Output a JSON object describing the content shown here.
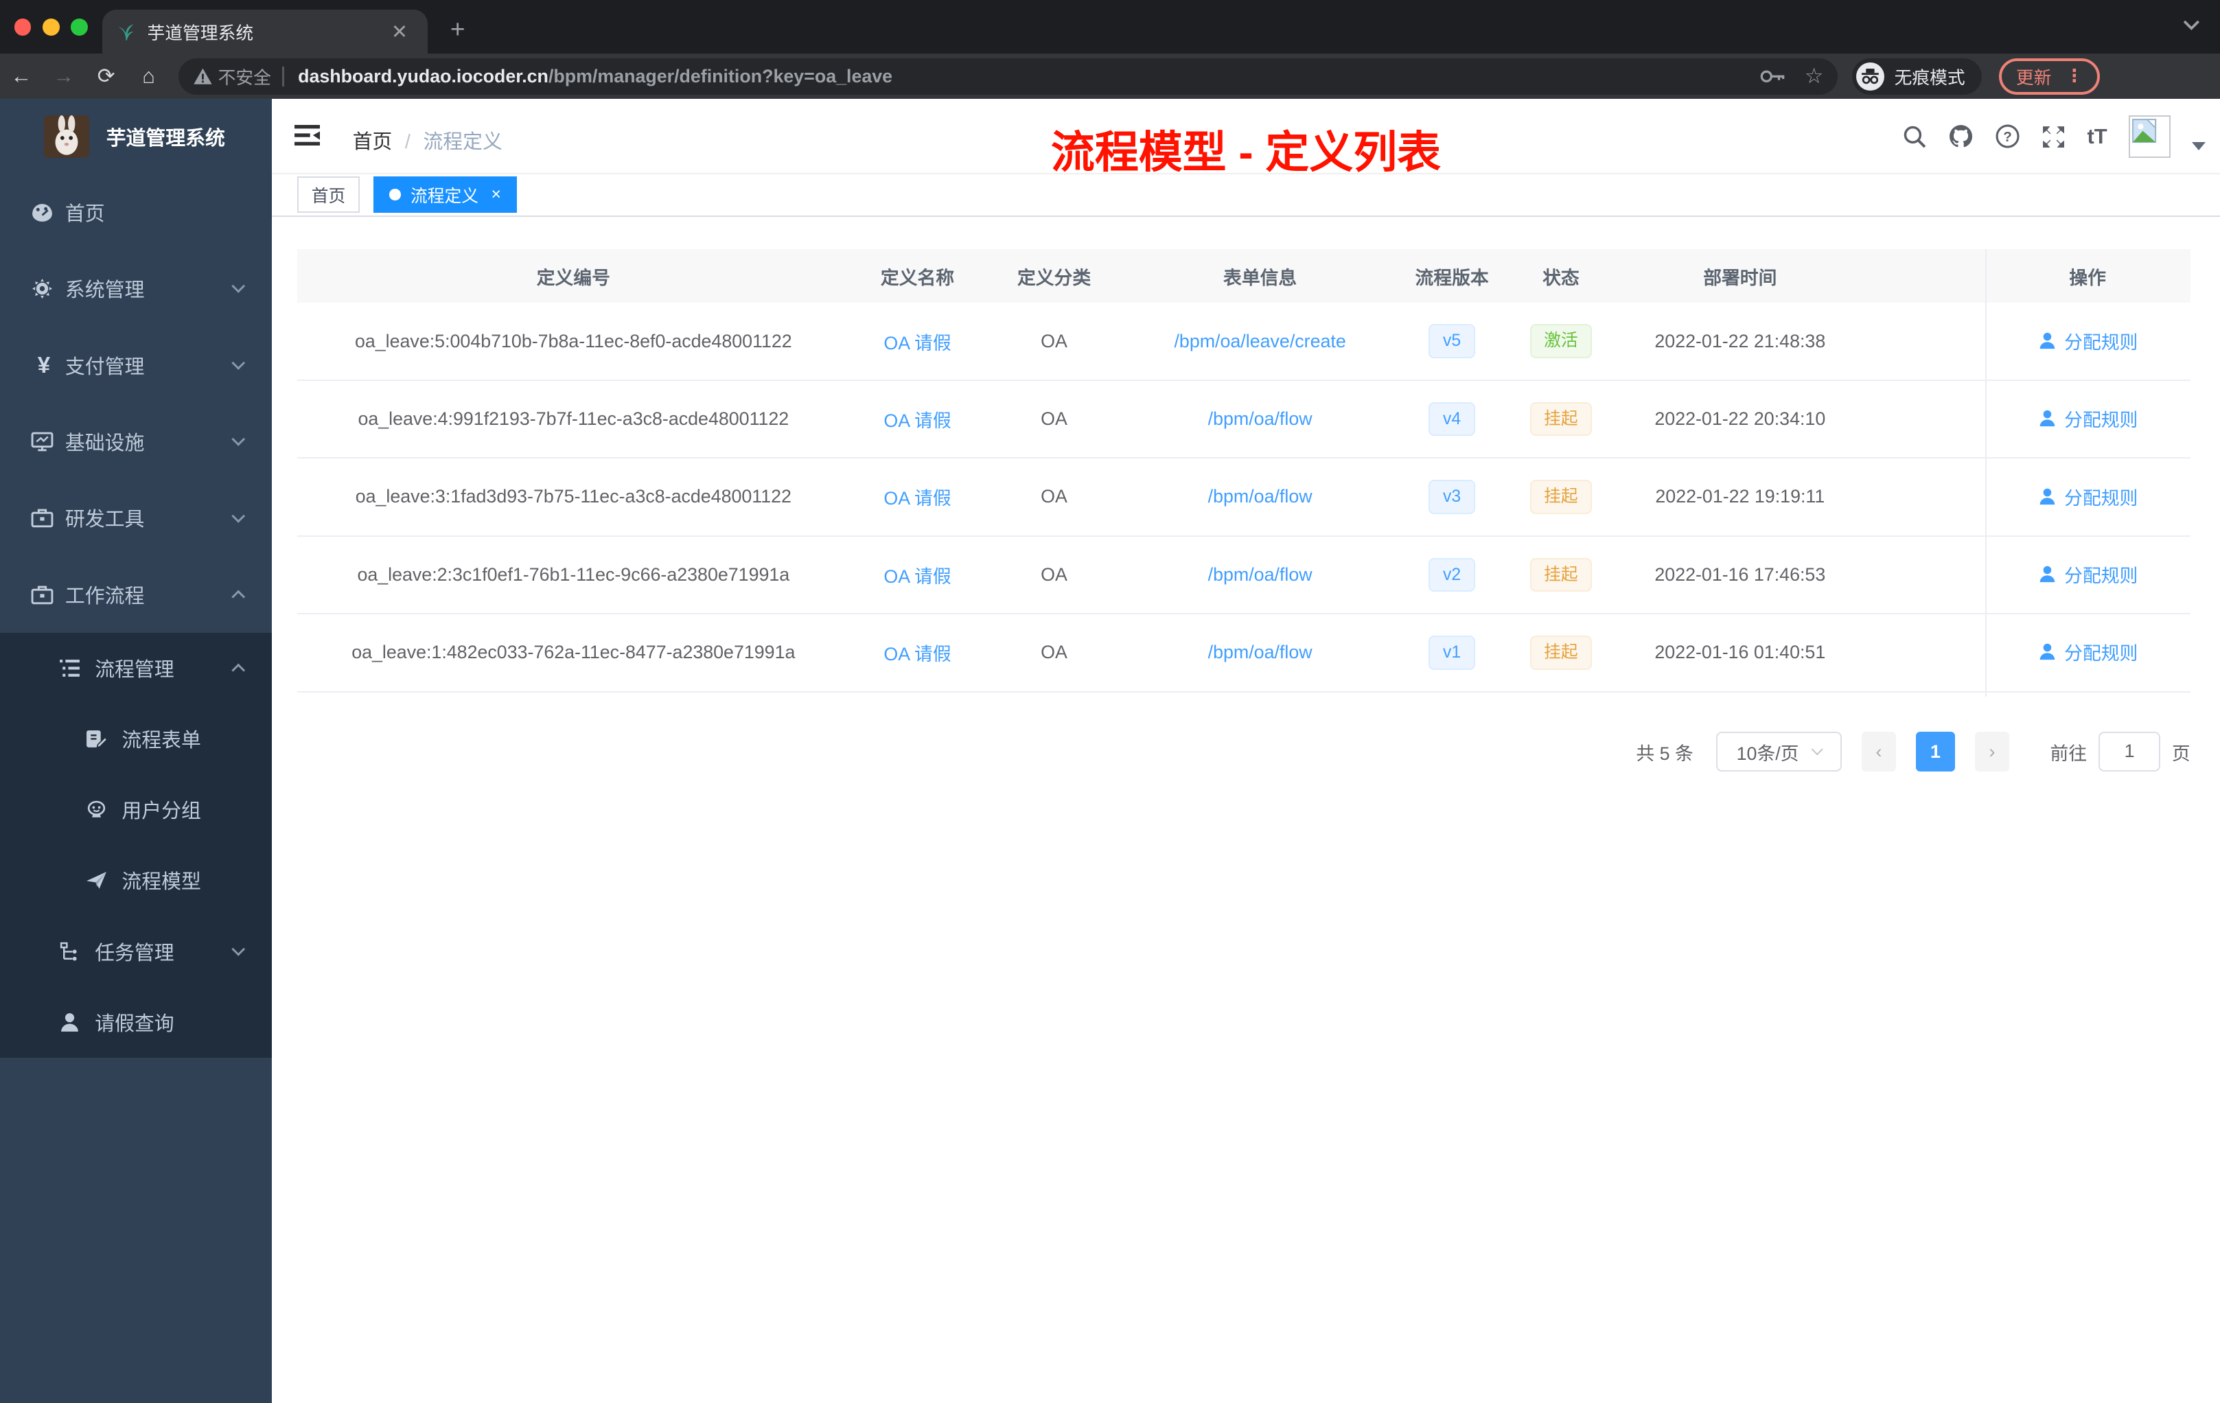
{
  "browser": {
    "tab_title": "芋道管理系统",
    "new_tab": "+",
    "close_tab": "✕",
    "security_label": "不安全",
    "url_host": "dashboard.yudao.iocoder.cn",
    "url_path": "/bpm/manager/definition?key=oa_leave",
    "incognito_label": "无痕模式",
    "update_label": "更新",
    "menu_dots": "⋮",
    "back": "←",
    "forward": "→",
    "reload": "⟳",
    "home": "⌂",
    "star": "☆"
  },
  "sidebar": {
    "logo_title": "芋道管理系统",
    "items": [
      {
        "label": "首页"
      },
      {
        "label": "系统管理"
      },
      {
        "label": "支付管理"
      },
      {
        "label": "基础设施"
      },
      {
        "label": "研发工具"
      },
      {
        "label": "工作流程"
      },
      {
        "label": "流程管理"
      },
      {
        "label": "流程表单"
      },
      {
        "label": "用户分组"
      },
      {
        "label": "流程模型"
      },
      {
        "label": "任务管理"
      },
      {
        "label": "请假查询"
      }
    ],
    "pay_icon_glyph": "¥"
  },
  "header": {
    "breadcrumb_home": "首页",
    "breadcrumb_separator": "/",
    "breadcrumb_current": "流程定义",
    "annotation": "流程模型 - 定义列表",
    "fontsize_icon_label": "tT"
  },
  "tags": {
    "home": "首页",
    "active": "流程定义",
    "close": "×"
  },
  "table": {
    "columns": [
      "定义编号",
      "定义名称",
      "定义分类",
      "表单信息",
      "流程版本",
      "状态",
      "部署时间",
      "操作"
    ],
    "action_label": "分配规则",
    "rows": [
      {
        "id": "oa_leave:5:004b710b-7b8a-11ec-8ef0-acde48001122",
        "name": "OA 请假",
        "category": "OA",
        "form": "/bpm/oa/leave/create",
        "version": "v5",
        "status": "激活",
        "time": "2022-01-22 21:48:38"
      },
      {
        "id": "oa_leave:4:991f2193-7b7f-11ec-a3c8-acde48001122",
        "name": "OA 请假",
        "category": "OA",
        "form": "/bpm/oa/flow",
        "version": "v4",
        "status": "挂起",
        "time": "2022-01-22 20:34:10"
      },
      {
        "id": "oa_leave:3:1fad3d93-7b75-11ec-a3c8-acde48001122",
        "name": "OA 请假",
        "category": "OA",
        "form": "/bpm/oa/flow",
        "version": "v3",
        "status": "挂起",
        "time": "2022-01-22 19:19:11"
      },
      {
        "id": "oa_leave:2:3c1f0ef1-76b1-11ec-9c66-a2380e71991a",
        "name": "OA 请假",
        "category": "OA",
        "form": "/bpm/oa/flow",
        "version": "v2",
        "status": "挂起",
        "time": "2022-01-16 17:46:53"
      },
      {
        "id": "oa_leave:1:482ec033-762a-11ec-8477-a2380e71991a",
        "name": "OA 请假",
        "category": "OA",
        "form": "/bpm/oa/flow",
        "version": "v1",
        "status": "挂起",
        "time": "2022-01-16 01:40:51"
      }
    ]
  },
  "pagination": {
    "total": "共 5 条",
    "page_size": "10条/页",
    "prev": "‹",
    "next": "›",
    "current_page": "1",
    "goto_label": "前往",
    "goto_value": "1",
    "page_unit": "页"
  },
  "colors": {
    "accent": "#409eff",
    "active_tag": "#1890ff",
    "status_active": "#67c23a",
    "status_suspended": "#e6a23c",
    "sidebar_bg": "#304156",
    "submenu_bg": "#1f2d3d",
    "update_button": "#ee8277"
  }
}
